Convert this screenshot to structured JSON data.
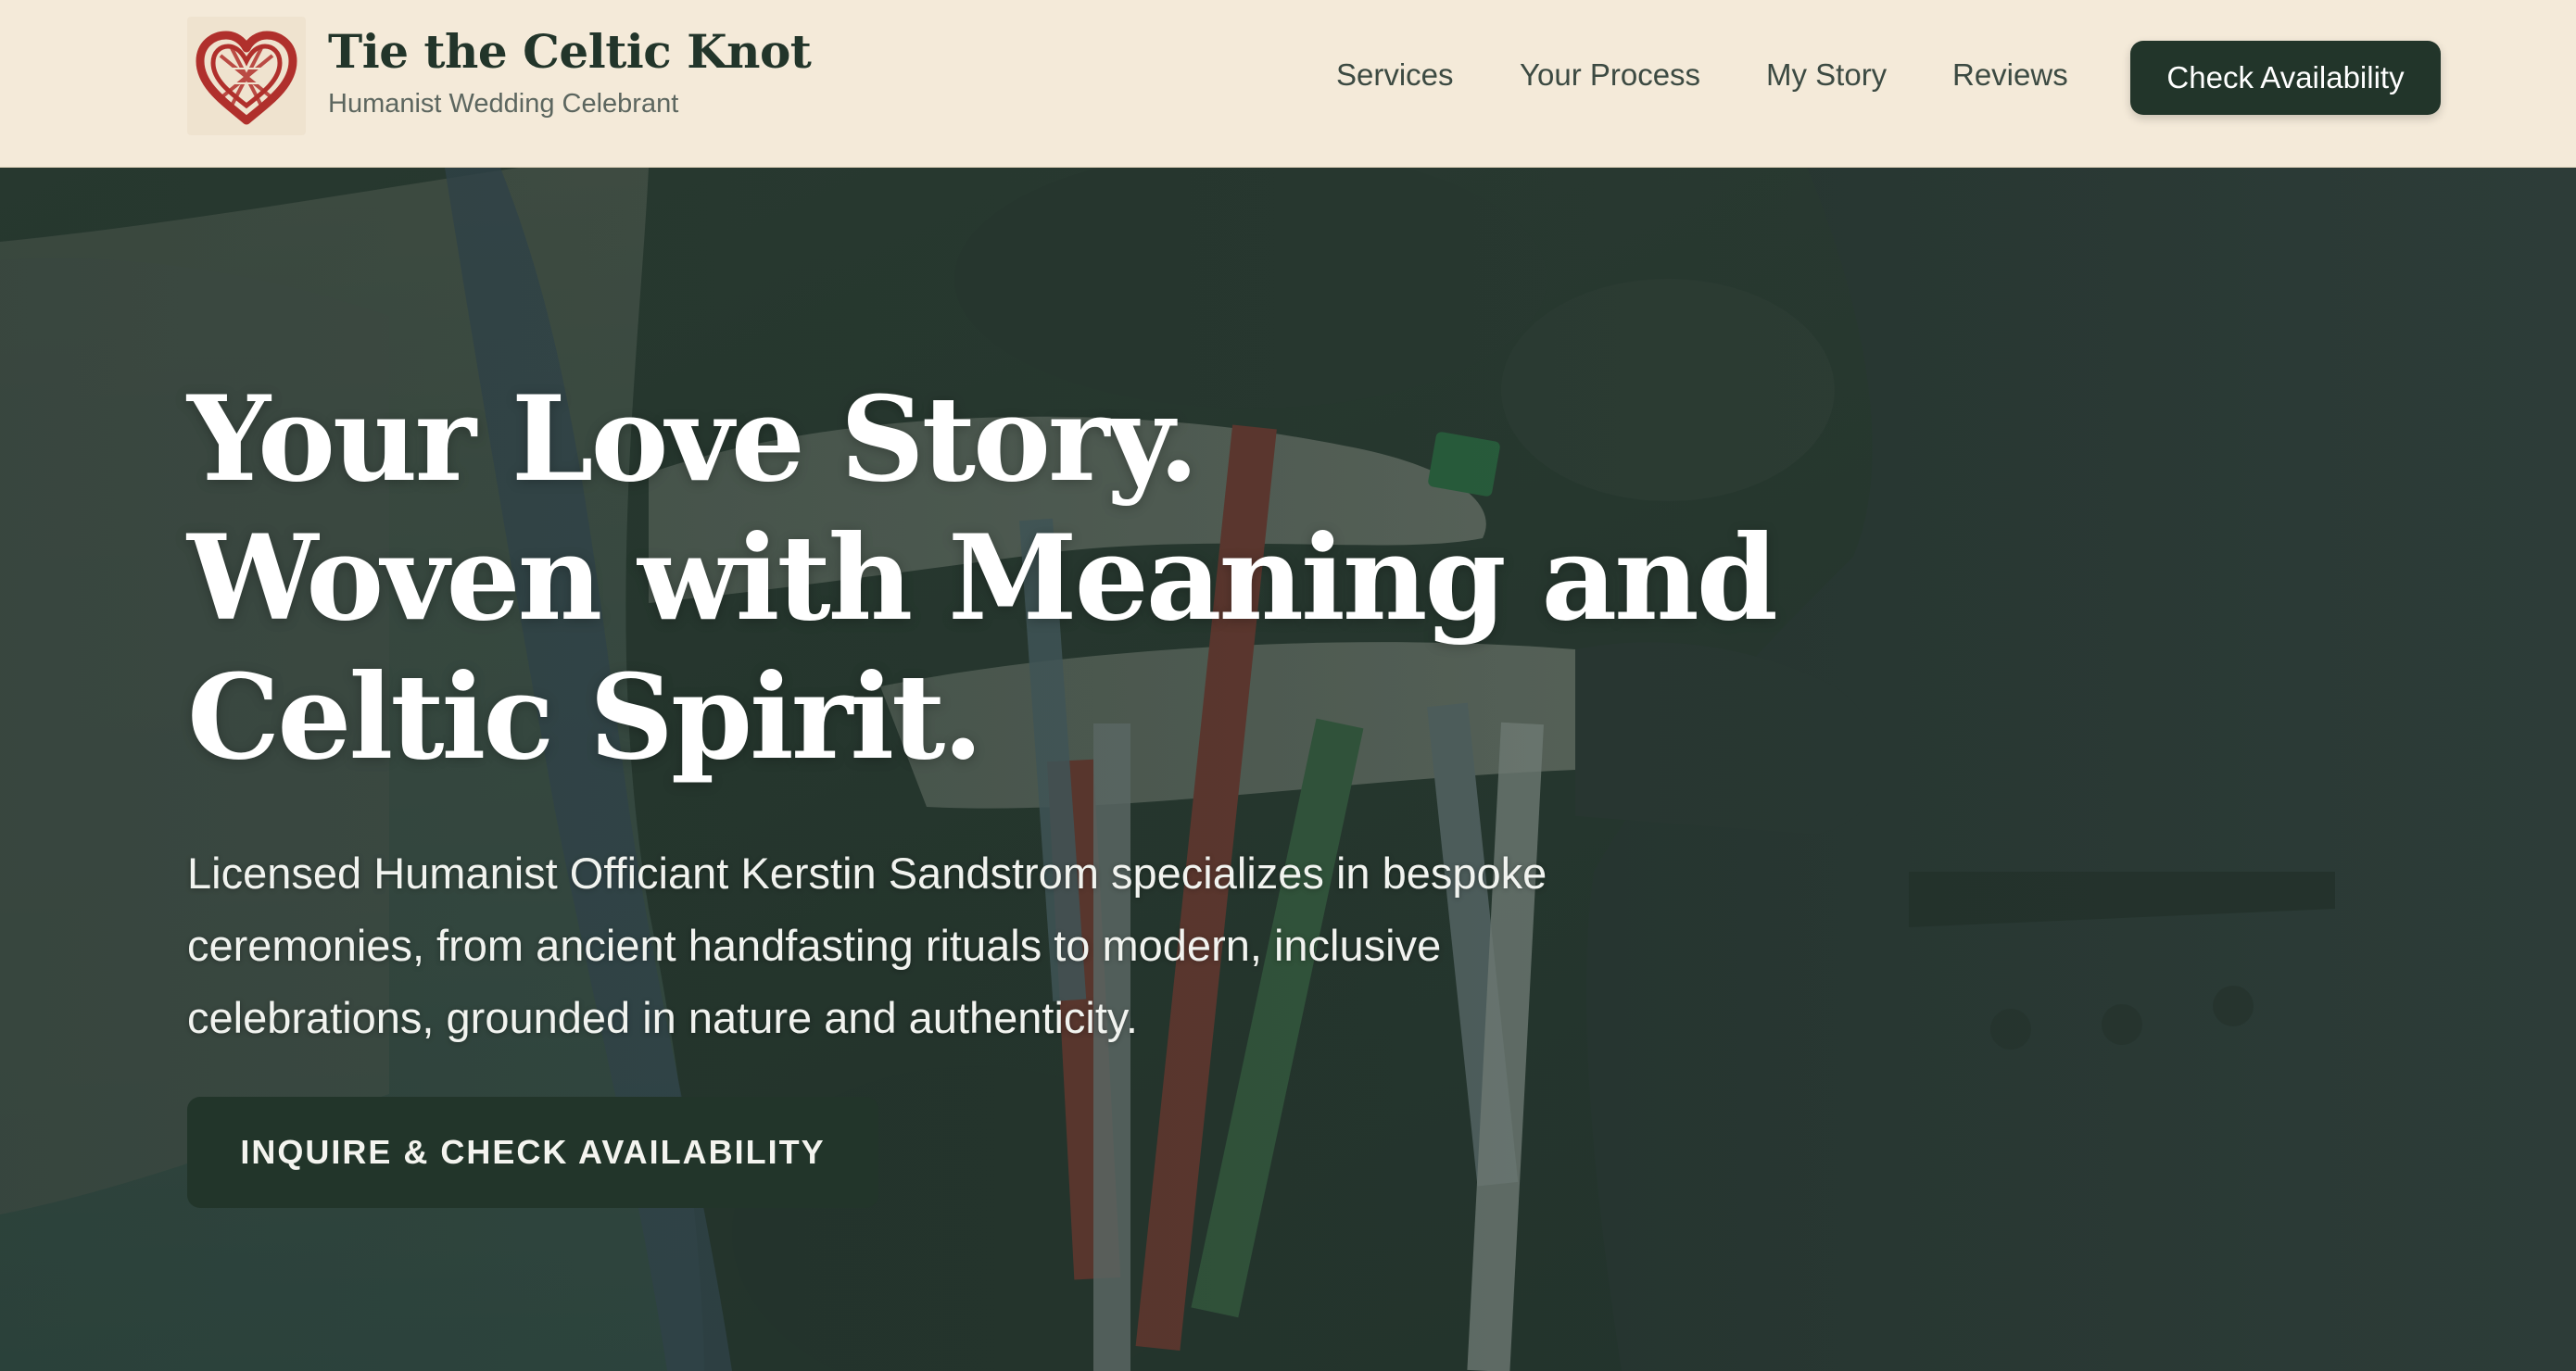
{
  "brand": {
    "title": "Tie the Celtic Knot",
    "subtitle": "Humanist Wedding Celebrant",
    "logo_icon": "celtic-knot-heart-icon"
  },
  "nav": {
    "items": [
      {
        "label": "Services"
      },
      {
        "label": "Your Process"
      },
      {
        "label": "My Story"
      },
      {
        "label": "Reviews"
      }
    ],
    "cta_label": "Check Availability"
  },
  "hero": {
    "headline_lines": [
      "Your Love Story.",
      "Woven with Meaning and",
      "Celtic Spirit."
    ],
    "lead": "Licensed Humanist Officiant Kerstin Sandstrom specializes in bespoke ceremonies, from ancient handfasting rituals to modern, inclusive celebrations, grounded in nature and authenticity.",
    "cta_label": "INQUIRE & CHECK AVAILABILITY"
  },
  "colors": {
    "header_bg": "#f4ead9",
    "brand_dark_green": "#22352a",
    "logo_red": "#b0302c",
    "hero_overlay": "#1c2c24"
  }
}
